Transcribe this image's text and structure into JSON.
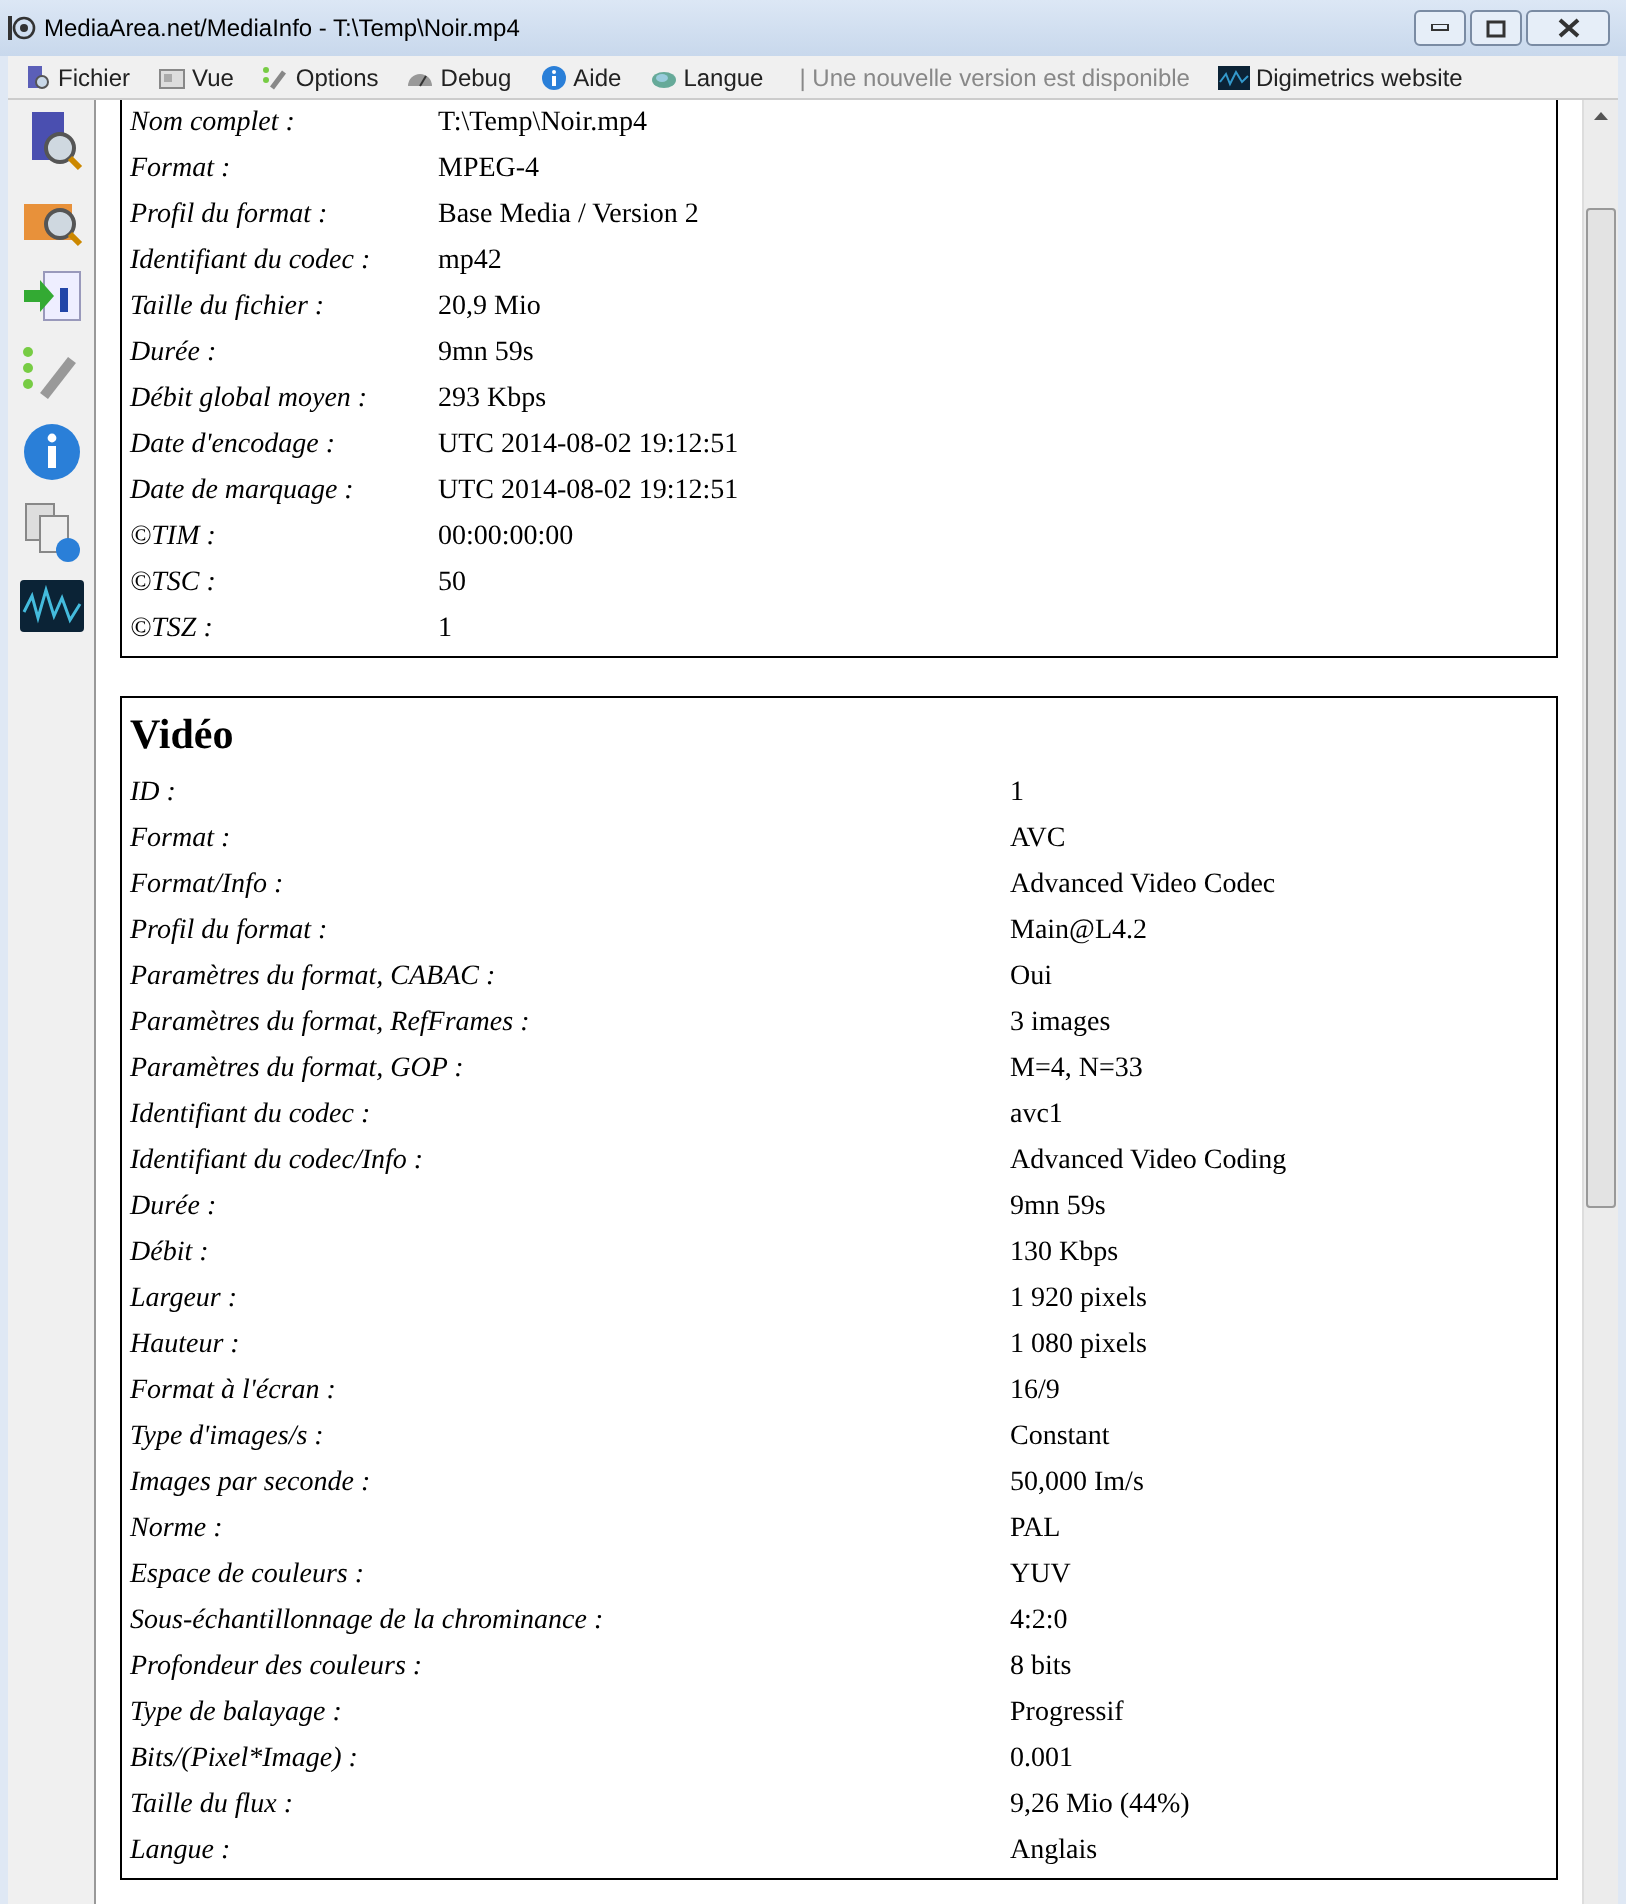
{
  "window": {
    "title": "MediaArea.net/MediaInfo - T:\\Temp\\Noir.mp4"
  },
  "menu": [
    {
      "label": "Fichier",
      "kind": "file"
    },
    {
      "label": "Vue",
      "kind": "view"
    },
    {
      "label": "Options",
      "kind": "options"
    },
    {
      "label": "Debug",
      "kind": "debug"
    },
    {
      "label": "Aide",
      "kind": "help"
    },
    {
      "label": "Langue",
      "kind": "language"
    }
  ],
  "notice": "| Une nouvelle version est disponible",
  "website_link": "Digimetrics website",
  "sections": [
    {
      "rows": [
        {
          "label": "Nom complet :",
          "value": "T:\\Temp\\Noir.mp4"
        },
        {
          "label": "Format :",
          "value": "MPEG-4"
        },
        {
          "label": "Profil du format :",
          "value": "Base Media / Version 2"
        },
        {
          "label": "Identifiant du codec :",
          "value": "mp42"
        },
        {
          "label": "Taille du fichier :",
          "value": "20,9 Mio"
        },
        {
          "label": "Durée :",
          "value": "9mn 59s"
        },
        {
          "label": "Débit global moyen :",
          "value": "293 Kbps"
        },
        {
          "label": "Date d'encodage :",
          "value": "UTC 2014-08-02 19:12:51"
        },
        {
          "label": "Date de marquage :",
          "value": "UTC 2014-08-02 19:12:51"
        },
        {
          "label": "©TIM :",
          "value": "00:00:00:00"
        },
        {
          "label": "©TSC :",
          "value": "50"
        },
        {
          "label": "©TSZ :",
          "value": "1"
        }
      ]
    },
    {
      "title": "Vidéo",
      "rows": [
        {
          "label": "ID :",
          "value": "1"
        },
        {
          "label": "Format :",
          "value": "AVC"
        },
        {
          "label": "Format/Info :",
          "value": "Advanced Video Codec"
        },
        {
          "label": "Profil du format :",
          "value": "Main@L4.2"
        },
        {
          "label": "Paramètres du format, CABAC :",
          "value": "Oui"
        },
        {
          "label": "Paramètres du format, RefFrames :",
          "value": "3 images"
        },
        {
          "label": "Paramètres du format, GOP :",
          "value": "M=4, N=33"
        },
        {
          "label": "Identifiant du codec :",
          "value": "avc1"
        },
        {
          "label": "Identifiant du codec/Info :",
          "value": "Advanced Video Coding"
        },
        {
          "label": "Durée :",
          "value": "9mn 59s"
        },
        {
          "label": "Débit :",
          "value": "130 Kbps"
        },
        {
          "label": "Largeur :",
          "value": "1 920 pixels"
        },
        {
          "label": "Hauteur :",
          "value": "1 080 pixels"
        },
        {
          "label": "Format à l'écran :",
          "value": "16/9"
        },
        {
          "label": "Type d'images/s :",
          "value": "Constant"
        },
        {
          "label": "Images par seconde :",
          "value": "50,000 Im/s"
        },
        {
          "label": "Norme :",
          "value": "PAL"
        },
        {
          "label": "Espace de couleurs :",
          "value": "YUV"
        },
        {
          "label": "Sous-échantillonnage de la chrominance :",
          "value": "4:2:0"
        },
        {
          "label": "Profondeur des couleurs :",
          "value": "8 bits"
        },
        {
          "label": "Type de balayage :",
          "value": "Progressif"
        },
        {
          "label": "Bits/(Pixel*Image) :",
          "value": "0.001"
        },
        {
          "label": "Taille du flux :",
          "value": "9,26 Mio (44%)"
        },
        {
          "label": "Langue :",
          "value": "Anglais"
        }
      ]
    }
  ]
}
